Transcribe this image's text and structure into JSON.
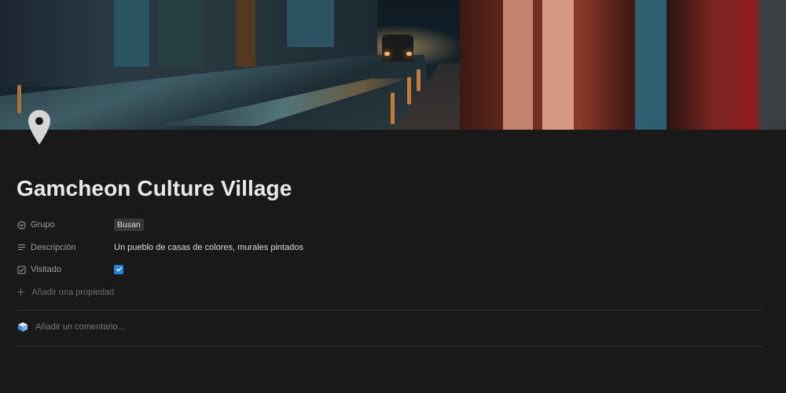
{
  "page": {
    "title": "Gamcheon Culture Village",
    "icon": "map-pin-icon"
  },
  "properties": [
    {
      "name": "Grupo",
      "icon": "select-icon",
      "type": "tag",
      "value": "Busan"
    },
    {
      "name": "Descripción",
      "icon": "text-lines-icon",
      "type": "text",
      "value": "Un pueblo de casas de colores, murales pintados"
    },
    {
      "name": "Visitado",
      "icon": "checkbox-icon",
      "type": "checkbox",
      "checked": true
    }
  ],
  "add_property_label": "Añadir una propiedad",
  "comment": {
    "placeholder": "Añadir un comentario...",
    "avatar_icon": "cube-avatar-icon"
  },
  "colors": {
    "background": "#191919",
    "accent_checkbox": "#2383e2",
    "tag_bg": "#373737"
  }
}
